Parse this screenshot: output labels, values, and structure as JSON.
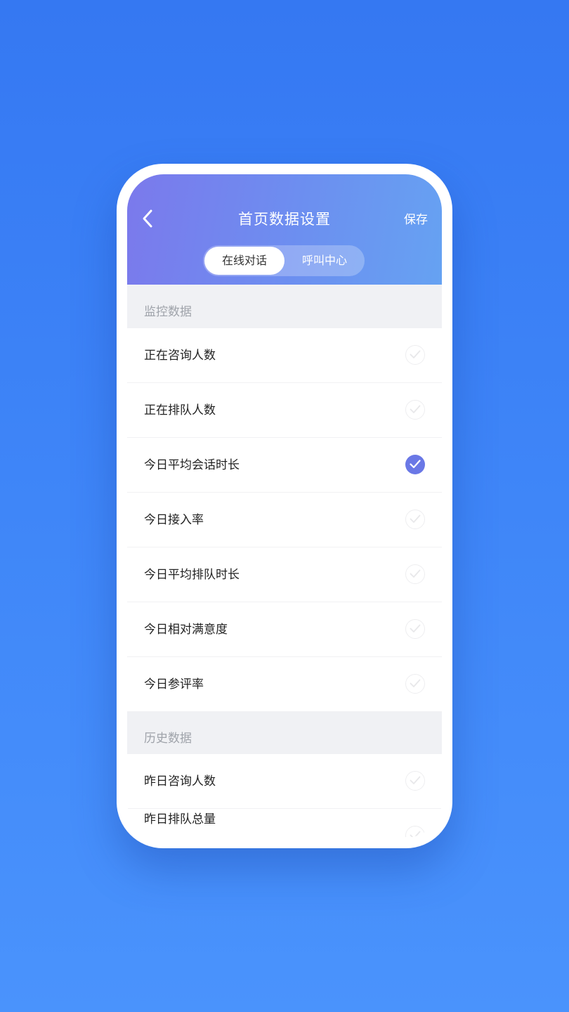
{
  "header": {
    "title": "首页数据设置",
    "save_label": "保存"
  },
  "tabs": {
    "active_label": "在线对话",
    "inactive_label": "呼叫中心"
  },
  "sections": {
    "monitor": {
      "title": "监控数据",
      "items": [
        {
          "label": "正在咨询人数",
          "checked": false
        },
        {
          "label": "正在排队人数",
          "checked": false
        },
        {
          "label": "今日平均会话时长",
          "checked": true
        },
        {
          "label": "今日接入率",
          "checked": false
        },
        {
          "label": "今日平均排队时长",
          "checked": false
        },
        {
          "label": "今日相对满意度",
          "checked": false
        },
        {
          "label": "今日参评率",
          "checked": false
        }
      ]
    },
    "history": {
      "title": "历史数据",
      "items": [
        {
          "label": "昨日咨询人数",
          "checked": false
        },
        {
          "label": "昨日排队总量",
          "checked": false
        }
      ]
    }
  },
  "colors": {
    "background": "#3f86f8",
    "header_gradient_start": "#7b79ec",
    "header_gradient_end": "#66a2f2",
    "check_active": "#6a78e6"
  },
  "icons": {
    "back": "chevron-left-icon",
    "check": "check-icon"
  }
}
